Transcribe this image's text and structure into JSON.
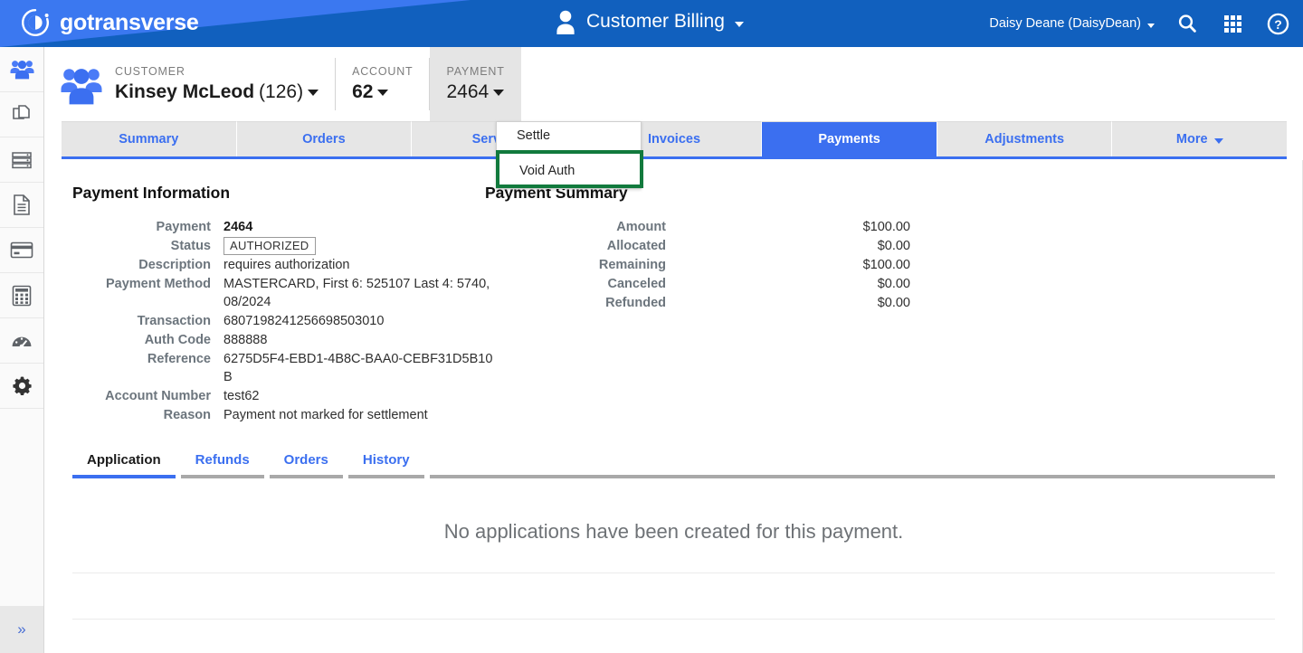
{
  "header": {
    "brand": "gotransverse",
    "brand_logo_icon": "gotransverse-circle-logo",
    "app_title": "Customer Billing",
    "app_title_icon": "user-avatar-icon",
    "user": "Daisy Deane (DaisyDean)",
    "search_icon": "search-icon",
    "apps_icon": "apps-grid-icon",
    "help_icon": "help-circle-icon",
    "colors": {
      "left": "#3b78f0",
      "right": "#1160be"
    }
  },
  "sidebar": {
    "items": [
      {
        "icon": "customers-people-icon",
        "active": true
      },
      {
        "icon": "documents-copy-icon",
        "active": false
      },
      {
        "icon": "servers-list-icon",
        "active": false
      },
      {
        "icon": "document-text-icon",
        "active": false
      },
      {
        "icon": "credit-card-icon",
        "active": false
      },
      {
        "icon": "calculator-icon",
        "active": false
      },
      {
        "icon": "dashboard-gauge-icon",
        "active": false
      },
      {
        "icon": "gear-settings-icon",
        "active": false
      }
    ],
    "expand_label": "»",
    "expand_icon": "double-chevron-right-icon"
  },
  "context": {
    "customer": {
      "label": "CUSTOMER",
      "name": "Kinsey McLeod",
      "id": "(126)",
      "icon": "customer-group-icon"
    },
    "account": {
      "label": "ACCOUNT",
      "value": "62"
    },
    "payment": {
      "label": "PAYMENT",
      "value": "2464"
    }
  },
  "tabs": [
    {
      "label": "Summary",
      "active": false,
      "caret": false
    },
    {
      "label": "Orders",
      "active": false,
      "caret": false
    },
    {
      "label": "Services",
      "active": false,
      "caret": false
    },
    {
      "label": "Invoices",
      "active": false,
      "caret": false
    },
    {
      "label": "Payments",
      "active": true,
      "caret": false
    },
    {
      "label": "Adjustments",
      "active": false,
      "caret": false
    },
    {
      "label": "More",
      "active": false,
      "caret": true
    }
  ],
  "dropdown": {
    "items": [
      {
        "label": "Settle",
        "highlighted": false
      },
      {
        "label": "Void Auth",
        "highlighted": true
      }
    ],
    "highlight_color": "#127a3d"
  },
  "payment_information": {
    "title": "Payment Information",
    "rows": [
      {
        "key": "Payment",
        "value": "2464",
        "bold": true
      },
      {
        "key": "Status",
        "value": "AUTHORIZED",
        "badge": true
      },
      {
        "key": "Description",
        "value": "requires authorization"
      },
      {
        "key": "Payment Method",
        "value": "MASTERCARD, First 6: 525107 Last 4: 5740, 08/2024"
      },
      {
        "key": "Transaction",
        "value": "6807198241256698503010"
      },
      {
        "key": "Auth Code",
        "value": "888888"
      },
      {
        "key": "Reference",
        "value": "6275D5F4-EBD1-4B8C-BAA0-CEBF31D5B10B"
      },
      {
        "key": "Account Number",
        "value": "test62"
      },
      {
        "key": "Reason",
        "value": "Payment not marked for settlement"
      }
    ]
  },
  "payment_summary": {
    "title": "Payment Summary",
    "rows": [
      {
        "key": "Amount",
        "value": "$100.00"
      },
      {
        "key": "Allocated",
        "value": "$0.00"
      },
      {
        "key": "Remaining",
        "value": "$100.00"
      },
      {
        "key": "Canceled",
        "value": "$0.00"
      },
      {
        "key": "Refunded",
        "value": "$0.00"
      }
    ]
  },
  "subtabs": [
    {
      "label": "Application",
      "active": true
    },
    {
      "label": "Refunds",
      "active": false
    },
    {
      "label": "Orders",
      "active": false
    },
    {
      "label": "History",
      "active": false
    }
  ],
  "empty_state": {
    "message": "No applications have been created for this payment."
  }
}
